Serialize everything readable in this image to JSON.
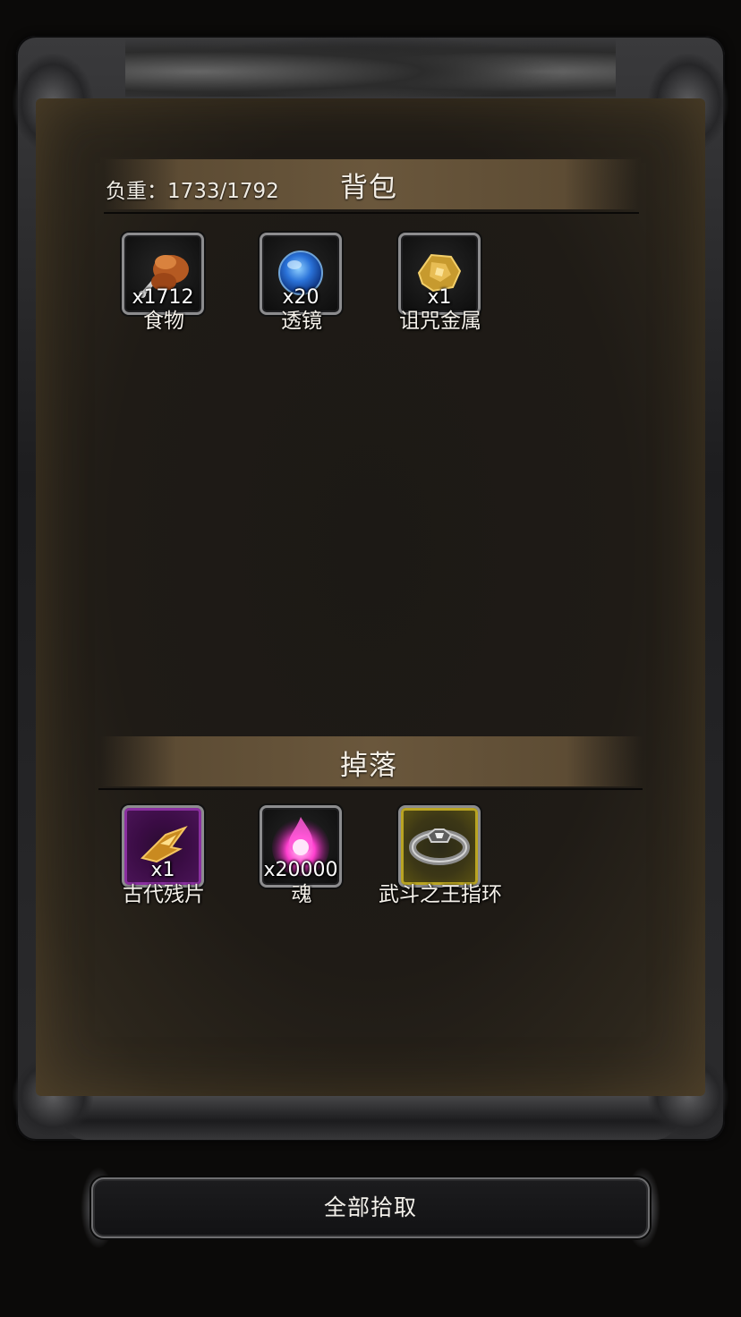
{
  "bag": {
    "title": "背包",
    "weight_text": "负重：1733/1792",
    "items": [
      {
        "name": "食物",
        "qty": "x1712",
        "icon": "food-icon"
      },
      {
        "name": "透镜",
        "qty": "x20",
        "icon": "lens-icon"
      },
      {
        "name": "诅咒金属",
        "qty": "x1",
        "icon": "cursed-metal-icon"
      }
    ]
  },
  "drops": {
    "title": "掉落",
    "items": [
      {
        "name": "古代残片",
        "qty": "x1",
        "icon": "ancient-fragment-icon",
        "rarity_color": "#8a2fa0"
      },
      {
        "name": "魂",
        "qty": "x20000",
        "icon": "soul-icon"
      },
      {
        "name": "武斗之王指环",
        "qty": "",
        "icon": "ring-icon",
        "rarity_color": "#b9a422"
      }
    ]
  },
  "actions": {
    "pick_all_label": "全部拾取"
  }
}
